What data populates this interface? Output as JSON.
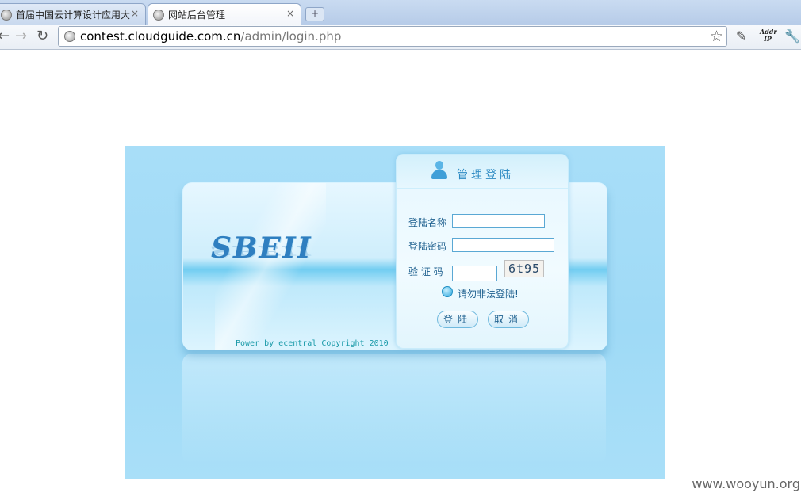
{
  "browser": {
    "tabs": [
      {
        "title": "首届中国云计算设计应用大",
        "active": false,
        "close": "×"
      },
      {
        "title": "网站后台管理",
        "active": true,
        "close": "×"
      }
    ],
    "new_tab": "+",
    "address": {
      "host": "contest.cloudguide.com.cn",
      "path": "/admin/login.php"
    },
    "addr_ip_label": "Addr IP"
  },
  "login": {
    "card_title": "管理登陆",
    "username_label": "登陆名称",
    "username_value": "",
    "password_label": "登陆密码",
    "password_value": "",
    "captcha_label": "验 证 码",
    "captcha_value": "",
    "captcha_image_text": "6t95",
    "warning": "请勿非法登陆!",
    "login_button": "登陆",
    "cancel_button": "取消"
  },
  "brand": {
    "logo": "SBEII",
    "copyright": "Power by ecentral Copyright 2010"
  },
  "watermark": "www.wooyun.org",
  "colors": {
    "page_bg": "#a4dcf7",
    "accent": "#2e8bc4"
  }
}
